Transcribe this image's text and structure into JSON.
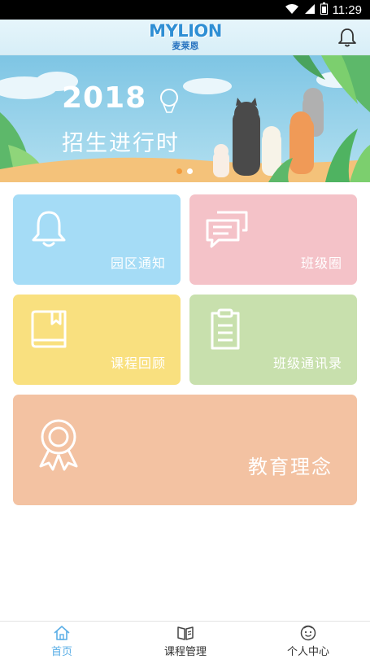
{
  "status_bar": {
    "time": "11:29"
  },
  "app_bar": {
    "logo_text": "MYLION",
    "logo_subtext": "麦莱恩"
  },
  "banner": {
    "year": "2018",
    "subtitle": "招生进行时",
    "slide_count": 2,
    "active_slide": 1
  },
  "tiles": [
    {
      "label": "园区通知",
      "icon": "bell-icon",
      "color": "#a5dcf6"
    },
    {
      "label": "班级圈",
      "icon": "chat-bubbles-icon",
      "color": "#f4c2c8"
    },
    {
      "label": "课程回顾",
      "icon": "book-icon",
      "color": "#f9e07f"
    },
    {
      "label": "班级通讯录",
      "icon": "clipboard-icon",
      "color": "#c8e0ad"
    },
    {
      "label": "教育理念",
      "icon": "award-ribbon-icon",
      "color": "#f3c2a2"
    }
  ],
  "bottom_nav": [
    {
      "label": "首页",
      "icon": "home-icon",
      "active": true
    },
    {
      "label": "课程管理",
      "icon": "open-book-icon",
      "active": false
    },
    {
      "label": "个人中心",
      "icon": "smiley-face-icon",
      "active": false
    }
  ],
  "colors": {
    "accent": "#5aaee6",
    "inactive": "#333333"
  }
}
